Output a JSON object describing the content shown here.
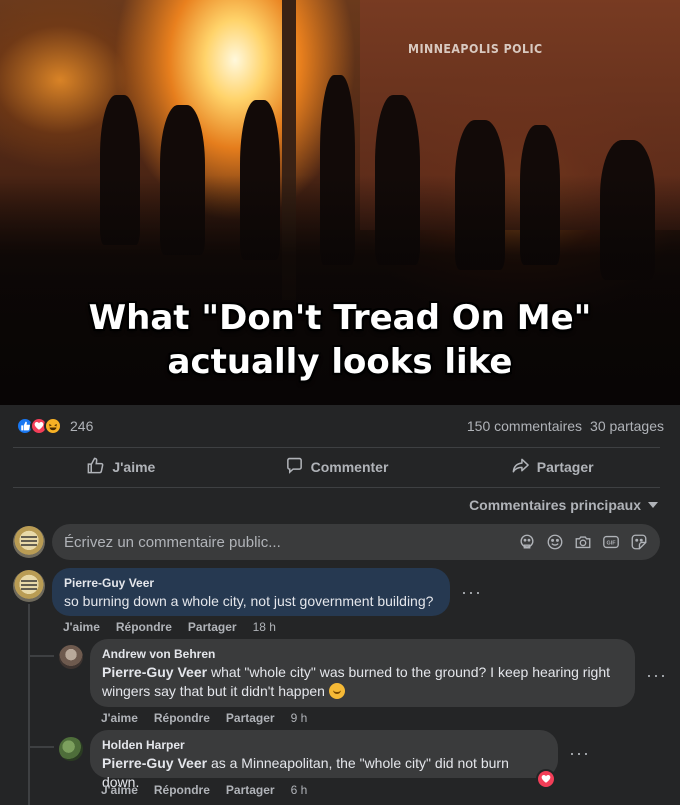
{
  "image": {
    "sign_text": "MINNEAPOLIS POLIC",
    "caption_line1": "What \"Don't Tread On Me\"",
    "caption_line2": "actually looks like"
  },
  "reactions": {
    "icons": [
      "like-icon",
      "love-icon",
      "haha-icon"
    ],
    "count": "246",
    "comments": "150 commentaires",
    "shares": "30 partages"
  },
  "actions": {
    "like": "J'aime",
    "comment": "Commenter",
    "share": "Partager"
  },
  "sort": {
    "label": "Commentaires principaux"
  },
  "compose": {
    "placeholder": "Écrivez un commentaire public..."
  },
  "comments": [
    {
      "author": "Pierre-Guy Veer",
      "text": "so burning down a whole city, not just government building?",
      "like": "J'aime",
      "reply": "Répondre",
      "share": "Partager",
      "time": "18 h",
      "bubble_color": "#263951"
    }
  ],
  "replies": [
    {
      "author": "Andrew von Behren",
      "mention": "Pierre-Guy Veer",
      "text": " what \"whole city\" was burned to the ground? I keep hearing right wingers say that but it didn't happen ",
      "emoji": "person-shrugging-emoji",
      "like": "J'aime",
      "reply": "Répondre",
      "share": "Partager",
      "time": "9 h"
    },
    {
      "author": "Holden Harper",
      "mention": "Pierre-Guy Veer",
      "text": " as a Minneapolitan, the \"whole city\" did not burn down.",
      "reaction": "love-icon",
      "like": "J'aime",
      "reply": "Répondre",
      "share": "Partager",
      "time": "6 h"
    }
  ],
  "colors": {
    "background": "#242526",
    "bubble": "#3a3b3c",
    "highlight_bubble": "#263951",
    "secondary_text": "#b0b3b8"
  }
}
